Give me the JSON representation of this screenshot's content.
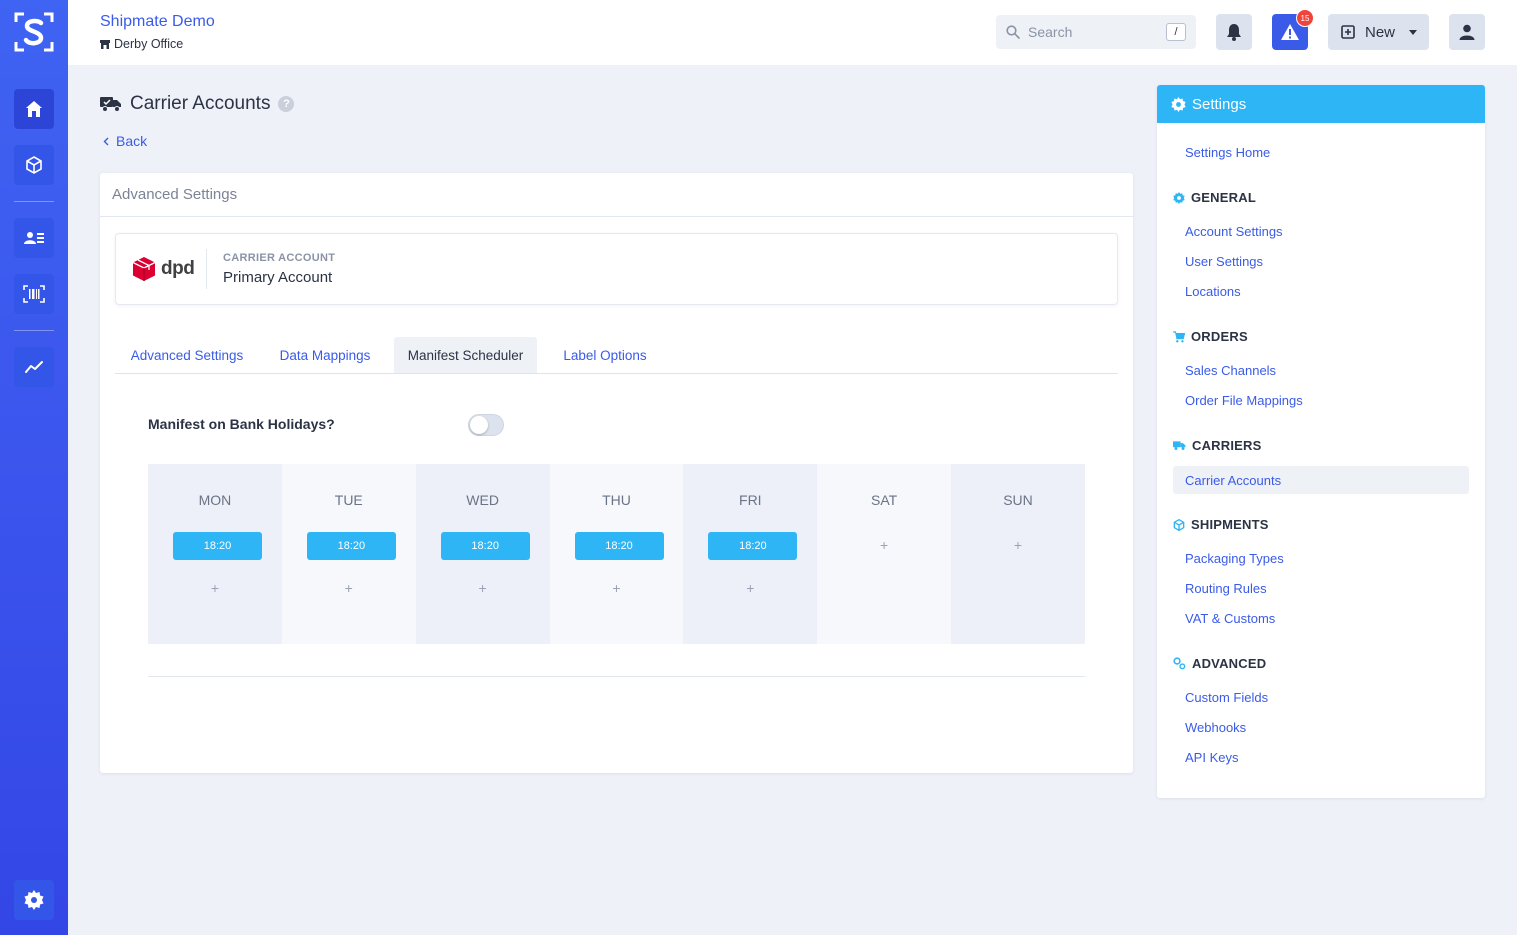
{
  "app": {
    "org_name": "Shipmate Demo",
    "location": "Derby Office",
    "search_placeholder": "Search",
    "search_shortcut": "/",
    "alert_count": "15",
    "new_label": "New"
  },
  "page": {
    "title": "Carrier Accounts",
    "back_label": "Back",
    "card_heading": "Advanced Settings",
    "carrier_logo_text": "dpd",
    "carrier_account_label": "CARRIER ACCOUNT",
    "carrier_account_name": "Primary Account",
    "tabs": [
      "Advanced Settings",
      "Data Mappings",
      "Manifest Scheduler",
      "Label Options"
    ],
    "active_tab": "Manifest Scheduler",
    "bank_holidays_label": "Manifest on Bank Holidays?",
    "bank_holidays_enabled": false,
    "days": [
      {
        "name": "MON",
        "time": "18:20"
      },
      {
        "name": "TUE",
        "time": "18:20"
      },
      {
        "name": "WED",
        "time": "18:20"
      },
      {
        "name": "THU",
        "time": "18:20"
      },
      {
        "name": "FRI",
        "time": "18:20"
      },
      {
        "name": "SAT",
        "time": ""
      },
      {
        "name": "SUN",
        "time": ""
      }
    ],
    "add_symbol": "+"
  },
  "settings": {
    "title": "Settings",
    "home": "Settings Home",
    "general": {
      "heading": "GENERAL",
      "items": [
        "Account Settings",
        "User Settings",
        "Locations"
      ]
    },
    "orders": {
      "heading": "ORDERS",
      "items": [
        "Sales Channels",
        "Order File Mappings"
      ]
    },
    "carriers": {
      "heading": "CARRIERS",
      "items": [
        "Carrier Accounts"
      ]
    },
    "shipments": {
      "heading": "SHIPMENTS",
      "items": [
        "Packaging Types",
        "Routing Rules",
        "VAT & Customs"
      ]
    },
    "advanced": {
      "heading": "ADVANCED",
      "items": [
        "Custom Fields",
        "Webhooks",
        "API Keys"
      ]
    }
  },
  "colors": {
    "brand": "#3a5be8",
    "accent": "#2eb5f5",
    "alert": "#f0433c",
    "dpd_red": "#dc0032"
  },
  "icons": [
    "logo-icon",
    "home-icon",
    "package-icon",
    "contacts-icon",
    "barcode-icon",
    "analytics-icon",
    "settings-gear-icon",
    "search-icon",
    "bell-icon",
    "warning-icon",
    "plus-square-icon",
    "caret-down-icon",
    "user-icon",
    "truck-icon",
    "help-icon",
    "chevron-left-icon"
  ]
}
